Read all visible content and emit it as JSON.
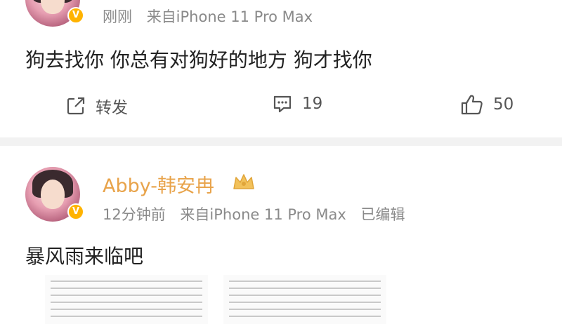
{
  "post1": {
    "time": "刚刚",
    "source": "来自iPhone 11 Pro Max",
    "content": "狗去找你 你总有对狗好的地方 狗才找你",
    "actions": {
      "repost_label": "转发",
      "comment_count": "19",
      "like_count": "50"
    }
  },
  "post2": {
    "username": "Abby-韩安冉",
    "time": "12分钟前",
    "source": "来自iPhone 11 Pro Max",
    "edited": "已编辑",
    "content": "暴风雨来临吧"
  },
  "colors": {
    "username": "#e8a34a",
    "meta_gray": "#8a8a8a",
    "divider": "#f2f2f2",
    "badge": "#ffb300"
  },
  "icons": [
    "verified-badge-icon",
    "share-icon",
    "comment-icon",
    "like-icon",
    "crown-icon"
  ]
}
